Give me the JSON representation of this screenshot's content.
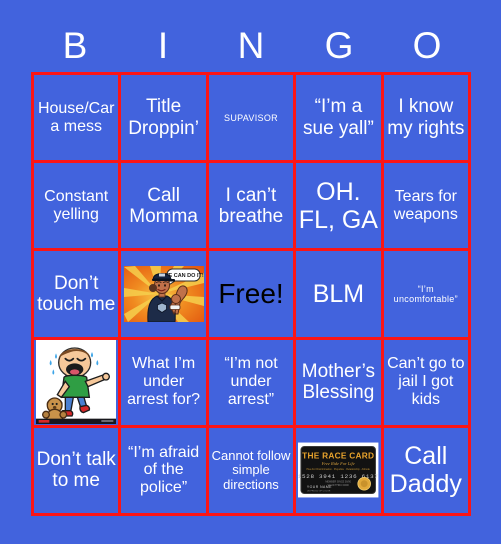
{
  "card": {
    "title_letters": [
      "B",
      "I",
      "N",
      "G",
      "O"
    ],
    "colors": {
      "background": "#4263dd",
      "cell_background": "#4263dd",
      "border": "#fb1515",
      "text": "#ffffff",
      "free_text": "#000000"
    }
  },
  "cells": [
    {
      "id": "b1",
      "text": "House/Car a mess",
      "type": "text",
      "size": "md"
    },
    {
      "id": "i1",
      "text": "Title Droppin’",
      "type": "text",
      "size": "lg"
    },
    {
      "id": "n1",
      "text": "SUPAVISOR",
      "type": "text",
      "size": "xs"
    },
    {
      "id": "g1",
      "text": "“I’m a sue yall”",
      "type": "text",
      "size": "lg"
    },
    {
      "id": "o1",
      "text": "I know my rights",
      "type": "text",
      "size": "lg"
    },
    {
      "id": "b2",
      "text": "Constant yelling",
      "type": "text",
      "size": "md"
    },
    {
      "id": "i2",
      "text": "Call Momma",
      "type": "text",
      "size": "lg"
    },
    {
      "id": "n2",
      "text": "I can’t breathe",
      "type": "text",
      "size": "lg"
    },
    {
      "id": "g2",
      "text": "OH. FL, GA",
      "type": "text",
      "size": "xl"
    },
    {
      "id": "o2",
      "text": "Tears for weapons",
      "type": "text",
      "size": "md"
    },
    {
      "id": "b3",
      "text": "Don’t touch me",
      "type": "text",
      "size": "lg"
    },
    {
      "id": "i3",
      "text": "",
      "type": "image",
      "image": "rosie-police-we-can-do-it",
      "caption": "WE CAN DO IT!"
    },
    {
      "id": "n3",
      "text": "Free!",
      "type": "free",
      "size": "xl"
    },
    {
      "id": "g3",
      "text": "BLM",
      "type": "text",
      "size": "xl"
    },
    {
      "id": "o3",
      "text": "“I’m uncomfortable”",
      "type": "text",
      "size": "xs"
    },
    {
      "id": "b4",
      "text": "",
      "type": "image",
      "image": "crying-child-pointing-teddy-bear"
    },
    {
      "id": "i4",
      "text": "What I’m under arrest for?",
      "type": "text",
      "size": "md"
    },
    {
      "id": "n4",
      "text": "“I’m not under arrest”",
      "type": "text",
      "size": "md"
    },
    {
      "id": "g4",
      "text": "Mother’s Blessing",
      "type": "text",
      "size": "lg"
    },
    {
      "id": "o4",
      "text": "Can’t go to jail I got kids",
      "type": "text",
      "size": "md"
    },
    {
      "id": "b5",
      "text": "Don’t talk to me",
      "type": "text",
      "size": "lg"
    },
    {
      "id": "i5",
      "text": "“I’m afraid of the police”",
      "type": "text",
      "size": "md"
    },
    {
      "id": "n5",
      "text": "Cannot follow simple directions",
      "type": "text",
      "size": "sm"
    },
    {
      "id": "g5",
      "text": "",
      "type": "image",
      "image": "the-race-card-credit-card"
    },
    {
      "id": "o5",
      "text": "Call Daddy",
      "type": "text",
      "size": "xl"
    }
  ],
  "artwork": {
    "race_card": {
      "title": "THE RACE CARD",
      "tagline": "Free Ride For Life",
      "subline": "Plea For Discrimination · Prejudice · Relationship · Attitude",
      "number": "1528 3941 1236 6137",
      "valid_label": "MEMBER SINCE  00/00",
      "expiry_label": "VALID THRU  00/00",
      "holder_label": "YOUR NAME",
      "holder_sub": "US PROUD OF COLOR"
    },
    "rosie": {
      "speech": "WE CAN DO IT!"
    }
  }
}
